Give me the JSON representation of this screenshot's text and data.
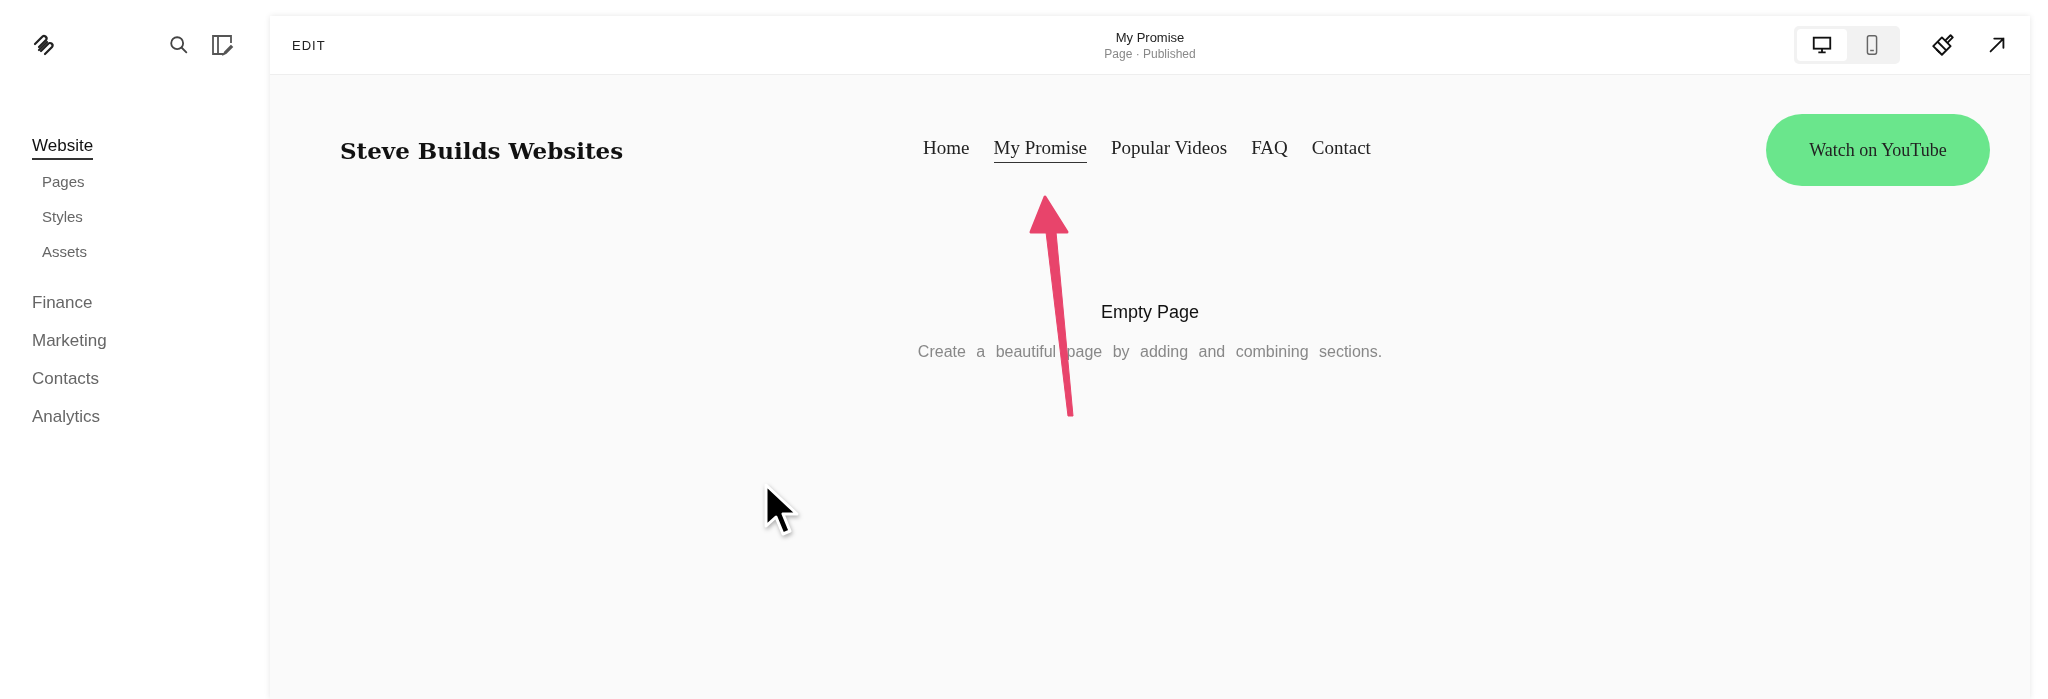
{
  "sidebar": {
    "sections": [
      {
        "label": "Website",
        "selected": true,
        "children": [
          {
            "label": "Pages"
          },
          {
            "label": "Styles"
          },
          {
            "label": "Assets"
          }
        ]
      },
      {
        "label": "Finance",
        "selected": false
      },
      {
        "label": "Marketing",
        "selected": false
      },
      {
        "label": "Contacts",
        "selected": false
      },
      {
        "label": "Analytics",
        "selected": false
      }
    ]
  },
  "toolbar": {
    "edit": "EDIT",
    "page_title": "My Promise",
    "page_status": "Page · Published",
    "views": [
      {
        "kind": "desktop",
        "selected": true
      },
      {
        "kind": "mobile",
        "selected": false
      }
    ]
  },
  "site": {
    "title": "Steve Builds Websites",
    "nav": [
      {
        "label": "Home",
        "selected": false
      },
      {
        "label": "My Promise",
        "selected": true
      },
      {
        "label": "Popular Videos",
        "selected": false
      },
      {
        "label": "FAQ",
        "selected": false
      },
      {
        "label": "Contact",
        "selected": false
      }
    ],
    "cta": "Watch on YouTube"
  },
  "empty_state": {
    "title": "Empty Page",
    "text": "Create a beautiful page by adding and combining sections."
  }
}
